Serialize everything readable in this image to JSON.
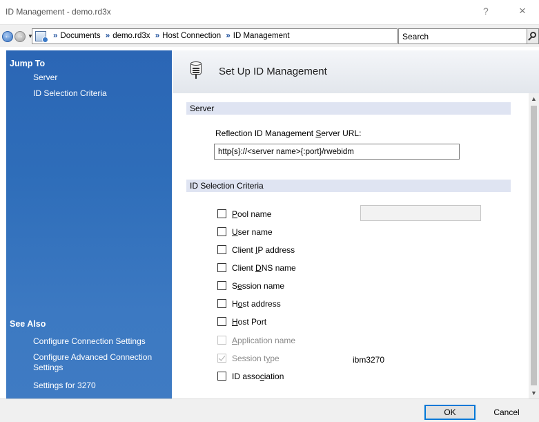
{
  "window": {
    "title": "ID Management - demo.rd3x",
    "help_glyph": "?",
    "close_glyph": "×"
  },
  "address_bar": {
    "crumbs": [
      "Documents",
      "demo.rd3x",
      "Host Connection",
      "ID Management"
    ],
    "separator": "»",
    "search_placeholder": "Search"
  },
  "left_panel": {
    "jump_to_heading": "Jump To",
    "jump_links": [
      "Server",
      "ID Selection Criteria"
    ],
    "see_also_heading": "See Also",
    "see_also_links": [
      "Configure Connection Settings",
      "Configure Advanced Connection Settings",
      "Settings for 3270"
    ]
  },
  "main": {
    "page_title": "Set Up ID Management",
    "server_section": {
      "heading": "Server",
      "url_label": "Reflection ID Management Server URL:",
      "url_value": "http{s}://<server name>{:port}/rwebidm"
    },
    "criteria_section": {
      "heading": "ID Selection Criteria",
      "options": [
        {
          "label": "Pool name",
          "checked": false,
          "disabled": false
        },
        {
          "label": "User name",
          "checked": false,
          "disabled": false
        },
        {
          "label": "Client IP address",
          "checked": false,
          "disabled": false
        },
        {
          "label": "Client DNS name",
          "checked": false,
          "disabled": false
        },
        {
          "label": "Session name",
          "checked": false,
          "disabled": false
        },
        {
          "label": "Host address",
          "checked": false,
          "disabled": false
        },
        {
          "label": "Host Port",
          "checked": false,
          "disabled": false
        },
        {
          "label": "Application name",
          "checked": false,
          "disabled": true
        },
        {
          "label": "Session type",
          "checked": true,
          "disabled": true
        },
        {
          "label": "ID association",
          "checked": false,
          "disabled": false
        }
      ],
      "pool_name_value": "",
      "session_type_value": "ibm3270"
    }
  },
  "buttons": {
    "ok": "OK",
    "cancel": "Cancel"
  },
  "colors": {
    "panel_blue": "#2e6db9",
    "section_header": "#dfe4f2",
    "accent": "#0078d7"
  }
}
